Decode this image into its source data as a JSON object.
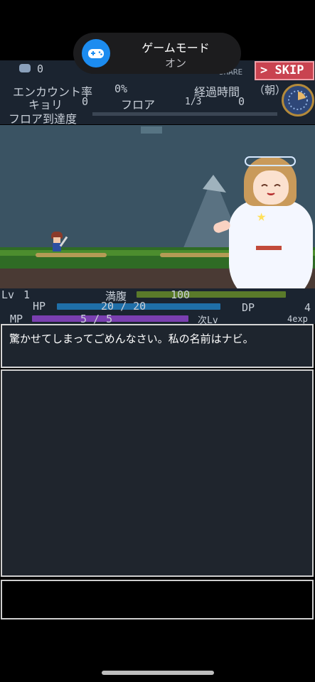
{
  "toast": {
    "title": "ゲームモード",
    "subtitle": "オン",
    "icon": "gamepad-icon"
  },
  "hud": {
    "gem_count": "0",
    "share_label": "SHARE",
    "skip_label": "SKIP",
    "encounter_label": "エンカウント率",
    "encounter_value": "0%",
    "elapsed_label": "経過時間",
    "time_of_day": "（朝）",
    "distance_label": "キョリ",
    "distance_value": "0",
    "floor_label": "フロア",
    "floor_progress": "1/3",
    "floor_value": "0",
    "floor_reach_label": "フロア到達度"
  },
  "stats": {
    "level_label": "Lv",
    "level_value": "1",
    "fullness_label": "満腹",
    "fullness_value": "100",
    "dp_label": "DP",
    "dp_value": "4",
    "hp_label": "HP",
    "hp_text": "20 / 20",
    "mp_label": "MP",
    "mp_text": "5 / 5",
    "next_label": "次Lv",
    "next_value": "4exp"
  },
  "dialogue": {
    "message": "驚かせてしまってごめんなさい。私の名前はナビ。"
  },
  "colors": {
    "skip_bg": "#c94350",
    "hp_bar": "#1f6fa8",
    "mp_bar": "#7a3fb0",
    "fullness_bar": "#5a7a2a"
  }
}
